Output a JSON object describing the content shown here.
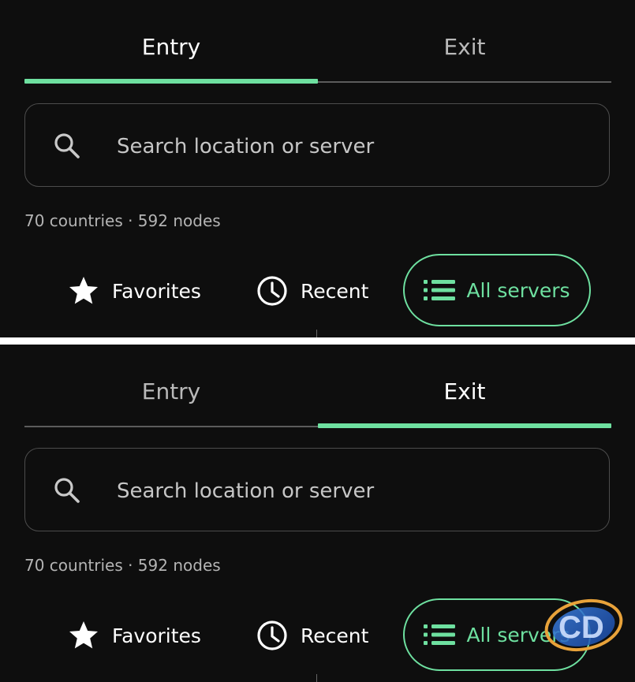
{
  "tabs": {
    "entry": "Entry",
    "exit": "Exit"
  },
  "search": {
    "placeholder": "Search location or server"
  },
  "stats": "70 countries · 592 nodes",
  "filters": {
    "favorites": "Favorites",
    "recent": "Recent",
    "all_servers": "All servers"
  },
  "colors": {
    "accent": "#6ee0a0",
    "background": "#0e0e0e",
    "outline": "#4c4c4c"
  },
  "icons": {
    "search": "search-icon",
    "favorites": "star-icon",
    "recent": "clock-icon",
    "all_servers": "list-icon"
  },
  "panels": [
    {
      "active_tab": "Entry"
    },
    {
      "active_tab": "Exit"
    }
  ]
}
